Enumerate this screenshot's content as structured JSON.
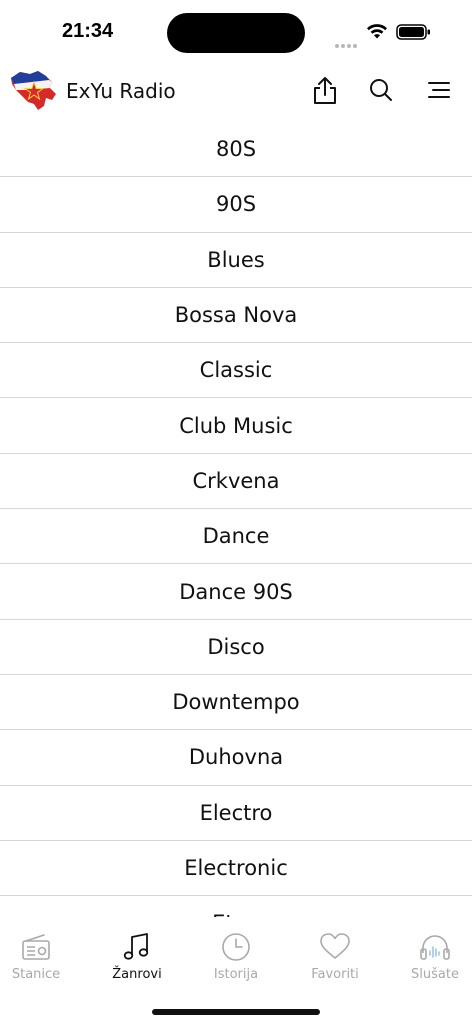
{
  "status": {
    "time": "21:34"
  },
  "header": {
    "title": "ExYu Radio"
  },
  "genres": [
    "80S",
    "90S",
    "Blues",
    "Bossa Nova",
    "Classic",
    "Club Music",
    "Crkvena",
    "Dance",
    "Dance 90S",
    "Disco",
    "Downtempo",
    "Duhovna",
    "Electro",
    "Electronic",
    "Etno"
  ],
  "tabs": [
    {
      "label": "Stanice",
      "icon": "radio-icon"
    },
    {
      "label": "Žanrovi",
      "icon": "music-note-icon",
      "active": true
    },
    {
      "label": "Istorija",
      "icon": "clock-icon"
    },
    {
      "label": "Favoriti",
      "icon": "heart-icon"
    },
    {
      "label": "Slušate",
      "icon": "headphones-icon"
    }
  ],
  "colors": {
    "active": "#111111",
    "inactive": "#a9a9a9",
    "divider": "#d6d6d6",
    "tab_icon_accent": "#9fc4e8"
  }
}
